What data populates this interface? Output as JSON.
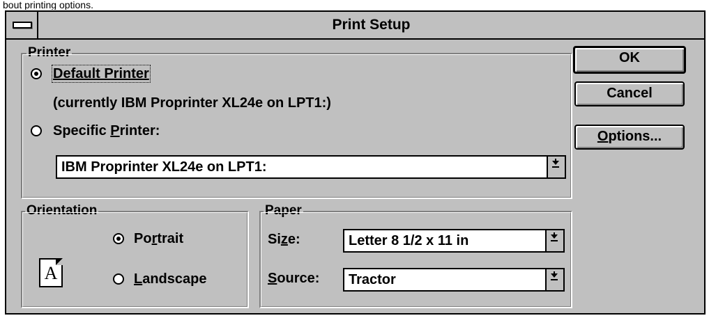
{
  "snippet_text": "bout printing options.",
  "window": {
    "title": "Print Setup"
  },
  "printer": {
    "legend": "Printer",
    "default_label": "Default Printer",
    "default_selected": true,
    "current_info": "(currently IBM Proprinter XL24e on LPT1:)",
    "specific_label_pre": "Specific ",
    "specific_label_key": "P",
    "specific_label_post": "rinter:",
    "specific_selected": false,
    "specific_value": "IBM Proprinter XL24e on LPT1:"
  },
  "orientation": {
    "legend": "Orientation",
    "page_glyph": "A",
    "portrait_pre": "Po",
    "portrait_key": "r",
    "portrait_post": "trait",
    "portrait_selected": true,
    "landscape_key": "L",
    "landscape_post": "andscape",
    "landscape_selected": false
  },
  "paper": {
    "legend": "Paper",
    "size_pre": "Si",
    "size_key": "z",
    "size_post": "e:",
    "size_value": "Letter 8 1/2 x 11 in",
    "source_key": "S",
    "source_post": "ource:",
    "source_value": "Tractor"
  },
  "buttons": {
    "ok": "OK",
    "cancel": "Cancel",
    "options_key": "O",
    "options_post": "ptions..."
  },
  "colors": {
    "face": "#c0c0c0",
    "shadow": "#808080",
    "highlight": "#ffffff",
    "frame": "#000000"
  },
  "icons": {
    "system_menu": "system-menu-bar-icon",
    "dropdown": "dropdown-arrow-icon",
    "page": "portrait-page-icon"
  }
}
